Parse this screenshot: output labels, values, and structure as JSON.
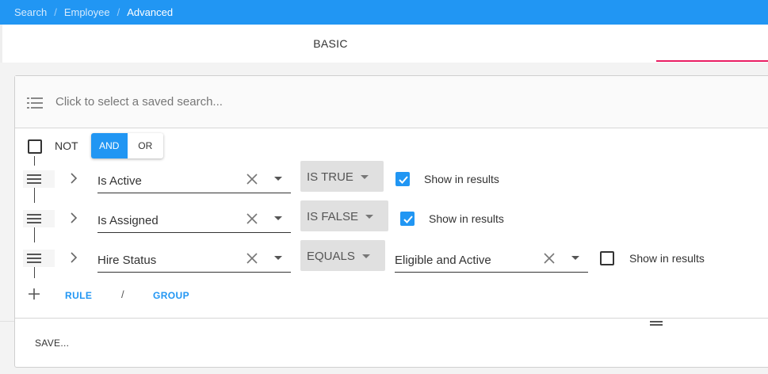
{
  "breadcrumb": [
    "Search",
    "Employee",
    "Advanced"
  ],
  "tabs": {
    "basic": "BASIC",
    "advanced": ""
  },
  "accent_color": "#2196f3",
  "tab_indicator_color": "#e91e63",
  "saved_search": {
    "placeholder": "Click to select a saved search...",
    "icon": "list-icon"
  },
  "group": {
    "not_label": "NOT",
    "and_label": "AND",
    "or_label": "OR",
    "active": "AND"
  },
  "rules": [
    {
      "field": "Is Active",
      "operator": "IS TRUE",
      "value": "",
      "show_in_results": true,
      "show_label": "Show in results"
    },
    {
      "field": "Is Assigned",
      "operator": "IS FALSE",
      "value": "",
      "show_in_results": true,
      "show_label": "Show in results"
    },
    {
      "field": "Hire Status",
      "operator": "EQUALS",
      "value": "Eligible and Active",
      "show_in_results": false,
      "show_label": "Show in results"
    }
  ],
  "add": {
    "rule": "RULE",
    "separator": "/",
    "group": "GROUP"
  },
  "footer": {
    "save": "SAVE..."
  }
}
